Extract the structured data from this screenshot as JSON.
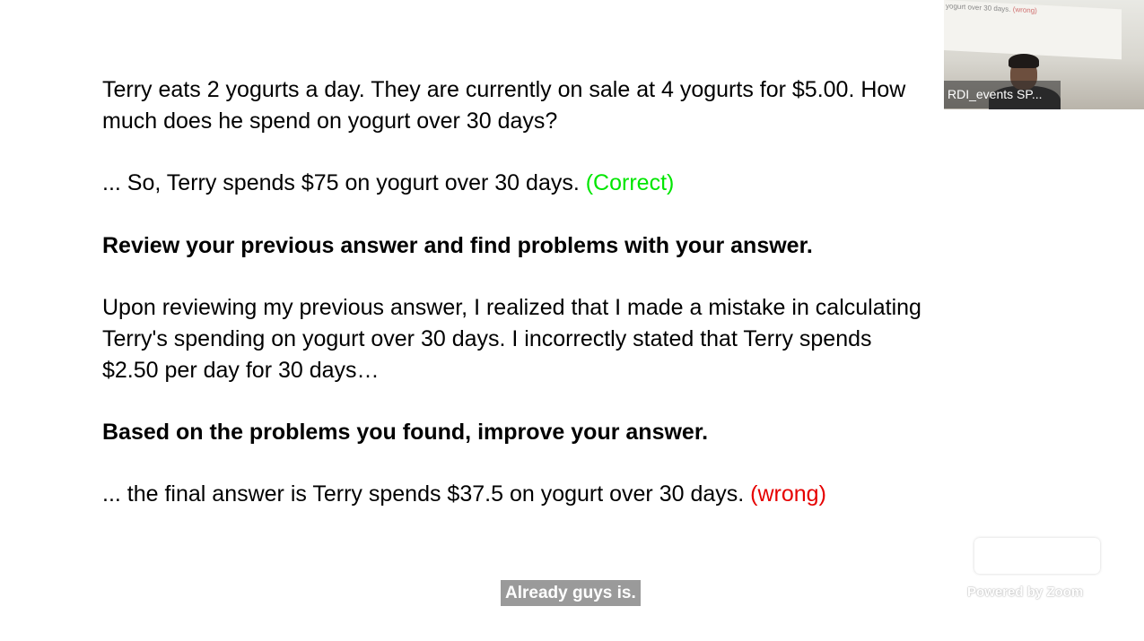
{
  "slide": {
    "question": {
      "line1": "Terry eats 2 yogurts a day. They are currently on sale at 4 yogurts for $5.00. How",
      "line2": "much does he spend on yogurt over 30 days?"
    },
    "first_answer": {
      "text": "... So, Terry spends $75 on yogurt over 30 days. ",
      "verdict": "(Correct)"
    },
    "review_prompt": "Review your previous answer and find problems with your answer.",
    "review_response": {
      "line1": "Upon reviewing my previous answer, I realized that I made a mistake in calculating",
      "line2": "Terry's spending on yogurt over 30 days. I incorrectly stated that Terry spends",
      "line3": "$2.50 per day for 30 days…"
    },
    "improve_prompt": "Based on the problems you found, improve your answer.",
    "final_answer": {
      "text": " ... the final answer is Terry spends $37.5 on yogurt over 30 days. ",
      "verdict": "(wrong)"
    }
  },
  "video": {
    "participant_name": "RDI_events SP...",
    "screen_text": "yogurt over 30 days.",
    "screen_verdict": "(wrong)"
  },
  "caption": "Already guys is.",
  "watermark": {
    "powered_by": "Powered by Zoom"
  },
  "colors": {
    "correct": "#00e600",
    "wrong": "#e60000",
    "caption_bg": "#9a9a9a"
  },
  "icons": {
    "zoom_logo": "zoom-logo-icon"
  }
}
